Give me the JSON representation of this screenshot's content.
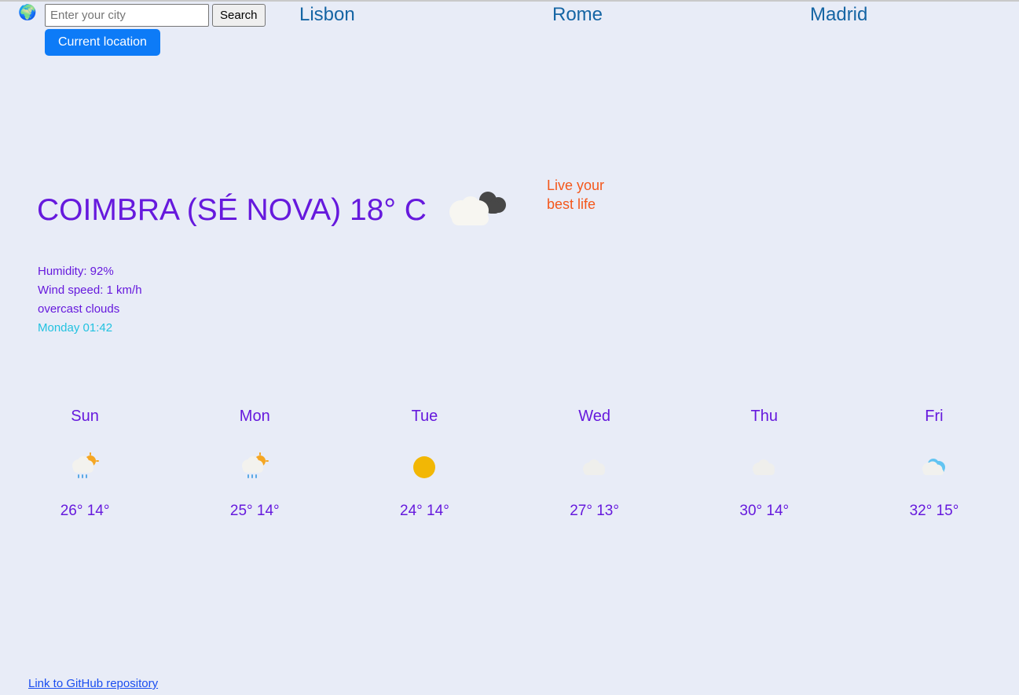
{
  "app": {
    "background_color": "#e8ecf7",
    "accent_purple": "#6619dd",
    "accent_blue": "#0d7bf7",
    "accent_cyan": "#22c2e0",
    "accent_orange": "#f4571b",
    "link_blue": "#1a4df0",
    "nav_link_color": "#1565a4"
  },
  "topbar": {
    "globe_icon": "globe-europe-africa-icon",
    "globe_glyph": "🌍",
    "search": {
      "placeholder": "Enter your city",
      "value": "",
      "button_label": "Search"
    },
    "current_location_label": "Current location",
    "city_links": [
      {
        "label": "Lisbon"
      },
      {
        "label": "Rome"
      },
      {
        "label": "Madrid"
      }
    ]
  },
  "current": {
    "heading": "COIMBRA (SÉ NOVA) 18° C",
    "city": "COIMBRA (SÉ NOVA)",
    "temperature": "18° C",
    "icon": "overcast-clouds-icon",
    "humidity": "Humidity: 92%",
    "wind_speed": "Wind speed: 1 km/h",
    "description": "overcast clouds",
    "datetime": "Monday 01:42"
  },
  "tagline": {
    "line1": "Live your",
    "line2": "best life"
  },
  "forecast": [
    {
      "day": "Sun",
      "icon": "sun-behind-rain-cloud-icon",
      "temps": "26° 14°",
      "high": "26°",
      "low": "14°"
    },
    {
      "day": "Mon",
      "icon": "sun-behind-rain-cloud-icon",
      "temps": "25° 14°",
      "high": "25°",
      "low": "14°"
    },
    {
      "day": "Tue",
      "icon": "sun-icon",
      "temps": "24° 14°",
      "high": "24°",
      "low": "14°"
    },
    {
      "day": "Wed",
      "icon": "cloud-icon",
      "temps": "27° 13°",
      "high": "27°",
      "low": "13°"
    },
    {
      "day": "Thu",
      "icon": "cloud-icon",
      "temps": "30° 14°",
      "high": "30°",
      "low": "14°"
    },
    {
      "day": "Fri",
      "icon": "cloud-blue-icon",
      "temps": "32° 15°",
      "high": "32°",
      "low": "15°"
    }
  ],
  "footer": {
    "github_link_label": "Link to GitHub repository"
  }
}
